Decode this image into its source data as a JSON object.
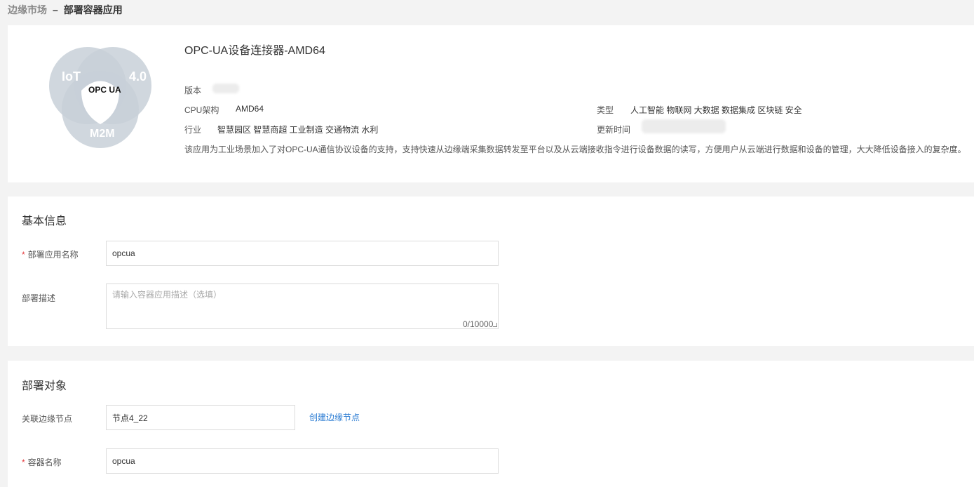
{
  "breadcrumb": {
    "root": "边缘市场",
    "separator": "–",
    "current": "部署容器应用"
  },
  "app": {
    "logo": {
      "circle_labels": [
        "IoT",
        "4.0",
        "M2M"
      ],
      "center_text": "OPC UA",
      "background_color": "#cfd7df",
      "center_color": "#ffffff"
    },
    "title": "OPC-UA设备连接器-AMD64",
    "version_label": "版本",
    "cpu_label": "CPU架构",
    "cpu_value": "AMD64",
    "type_label": "类型",
    "type_value": "人工智能 物联网 大数据 数据集成 区块链 安全",
    "industry_label": "行业",
    "industry_value": "智慧园区 智慧商超 工业制造 交通物流 水利",
    "update_label": "更新时间",
    "description": "该应用为工业场景加入了对OPC-UA通信协议设备的支持，支持快速从边缘端采集数据转发至平台以及从云端接收指令进行设备数据的读写，方便用户从云端进行数据和设备的管理，大大降低设备接入的复杂度。"
  },
  "basic_info": {
    "title": "基本信息",
    "app_name_label": "部署应用名称",
    "app_name_value": "opcua",
    "desc_label": "部署描述",
    "desc_placeholder": "请输入容器应用描述（选填）",
    "desc_counter": "0/10000"
  },
  "deploy_target": {
    "title": "部署对象",
    "node_label": "关联边缘节点",
    "node_value": "节点4_22",
    "create_node_link": "创建边缘节点",
    "container_label": "容器名称",
    "container_value": "opcua"
  },
  "colors": {
    "accent_link": "#2b7cd3",
    "required_mark": "#e4393c",
    "page_background": "#f3f3f3"
  }
}
